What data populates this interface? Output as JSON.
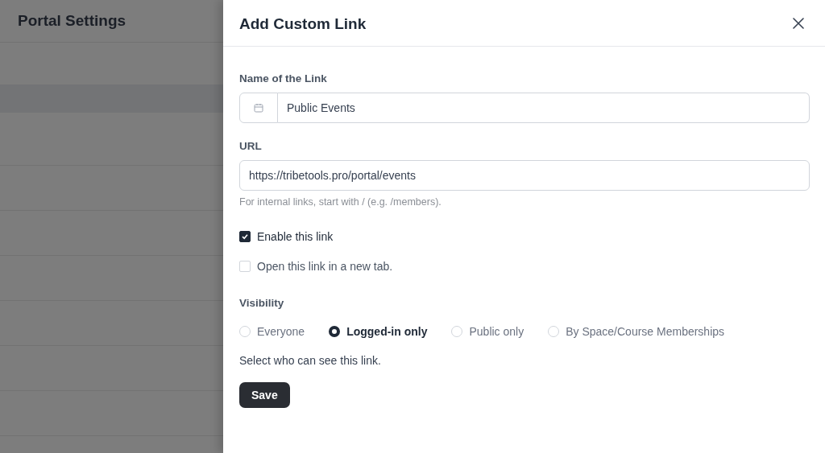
{
  "background": {
    "title": "Portal Settings"
  },
  "drawer": {
    "title": "Add Custom Link",
    "name_field": {
      "label": "Name of the Link",
      "value": "Public Events"
    },
    "url_field": {
      "label": "URL",
      "value": "https://tribetools.pro/portal/events",
      "hint": "For internal links, start with / (e.g. /members)."
    },
    "checkboxes": [
      {
        "label": "Enable this link",
        "checked": true
      },
      {
        "label": "Open this link in a new tab.",
        "checked": false
      }
    ],
    "visibility": {
      "label": "Visibility",
      "options": [
        {
          "label": "Everyone",
          "selected": false
        },
        {
          "label": "Logged-in only",
          "selected": true
        },
        {
          "label": "Public only",
          "selected": false
        },
        {
          "label": "By Space/Course Memberships",
          "selected": false
        }
      ],
      "help": "Select who can see this link."
    },
    "save_button": "Save"
  }
}
